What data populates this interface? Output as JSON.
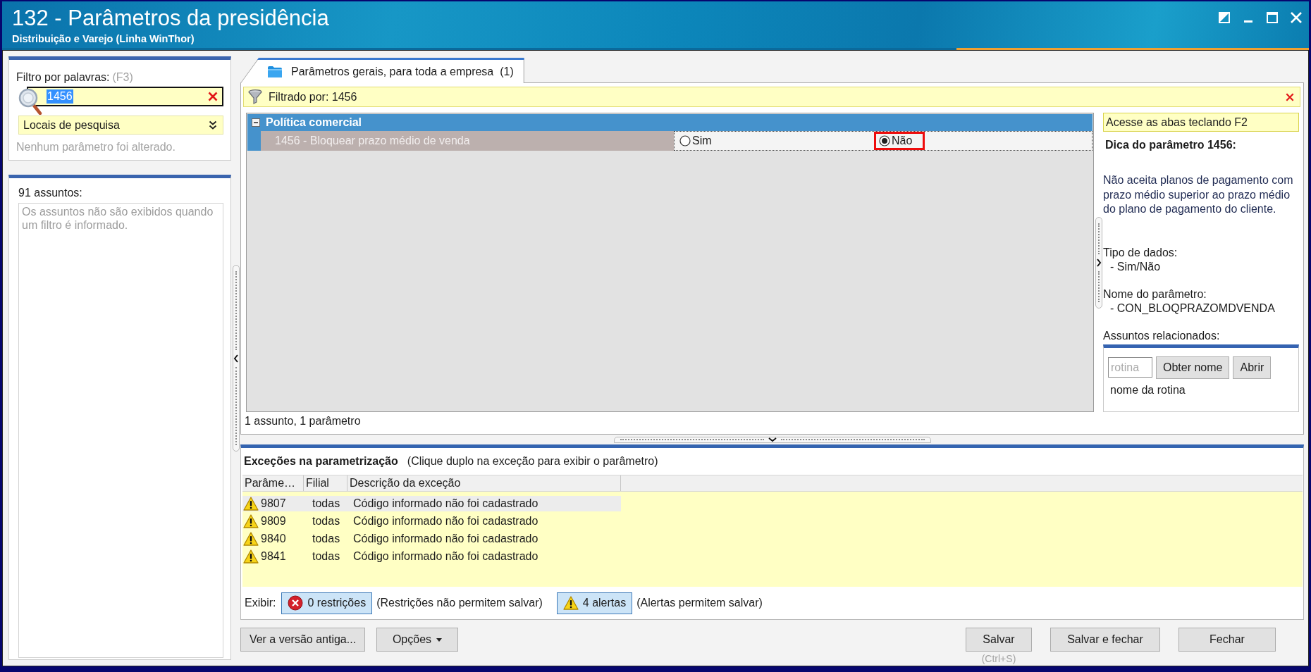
{
  "window": {
    "title": "132 - Parâmetros da presidência",
    "subtitle": "Distribuição e Varejo (Linha WinThor)"
  },
  "filter_panel": {
    "label": "Filtro por palavras:",
    "shortcut": "(F3)",
    "search": {
      "value": "1456",
      "text_selected": true
    },
    "locations_dropdown": {
      "label": "Locais de pesquisa"
    },
    "status": "Nenhum parâmetro foi alterado."
  },
  "subjects_panel": {
    "title": "91 assuntos:",
    "message": "Os assuntos não são exibidos quando um filtro é informado."
  },
  "tabs": [
    {
      "label": "Parâmetros gerais, para toda a empresa  (1)",
      "selected": true
    }
  ],
  "filter_bar": {
    "text": "Filtrado por: 1456"
  },
  "parameter_groups": [
    {
      "title": "Política comercial",
      "expanded": true,
      "parameters": [
        {
          "label": "1456 - Bloquear prazo médio de venda",
          "selected": true,
          "options": [
            {
              "label": "Sim",
              "selected": false,
              "callout": false
            },
            {
              "label": "Não",
              "selected": true,
              "callout": true
            }
          ]
        }
      ]
    }
  ],
  "grid_summary": "1 assunto, 1 parâmetro",
  "tip_panel": {
    "hint": "Acesse as abas teclando F2",
    "title": "Dica do parâmetro 1456:",
    "description": "Não aceita planos de pagamento com prazo médio superior ao prazo médio do plano de pagamento do cliente.",
    "data_type": {
      "label": "Tipo de dados:",
      "value": "- Sim/Não"
    },
    "parameter_name": {
      "label": "Nome do parâmetro:",
      "value": "- CON_BLOQPRAZOMDVENDA"
    },
    "related": {
      "label": "Assuntos relacionados:",
      "routine_field": {
        "placeholder": "rotina"
      },
      "buttons": [
        "Obter nome",
        "Abrir"
      ],
      "routine_name": "nome da rotina"
    }
  },
  "exceptions": {
    "title": "Exceções na parametrização",
    "hint": "(Clique duplo na exceção para exibir o parâmetro)",
    "columns": [
      "Parâme…",
      "Filial",
      "Descrição da exceção"
    ],
    "rows": [
      {
        "kind": "alert",
        "parameter": "9807",
        "branch": "todas",
        "description": "Código informado não foi cadastrado",
        "selected": true
      },
      {
        "kind": "alert",
        "parameter": "9809",
        "branch": "todas",
        "description": "Código informado não foi cadastrado",
        "selected": false
      },
      {
        "kind": "alert",
        "parameter": "9840",
        "branch": "todas",
        "description": "Código informado não foi cadastrado",
        "selected": false
      },
      {
        "kind": "alert",
        "parameter": "9841",
        "branch": "todas",
        "description": "Código informado não foi cadastrado",
        "selected": false
      }
    ],
    "display": {
      "label": "Exibir:",
      "filters": [
        {
          "kind": "restriction",
          "label": "0 restrições",
          "note": "(Restrições não permitem salvar)",
          "selected": true
        },
        {
          "kind": "alert",
          "label": "4 alertas",
          "note": "(Alertas permitem salvar)",
          "selected": true
        }
      ]
    }
  },
  "actions": {
    "left": [
      {
        "kind": "button",
        "label": "Ver a versão antiga..."
      },
      {
        "kind": "menu",
        "label": "Opções"
      }
    ],
    "right": [
      {
        "label": "Salvar",
        "shortcut": "(Ctrl+S)"
      },
      {
        "label": "Salvar e fechar"
      },
      {
        "label": "Fechar"
      }
    ]
  }
}
